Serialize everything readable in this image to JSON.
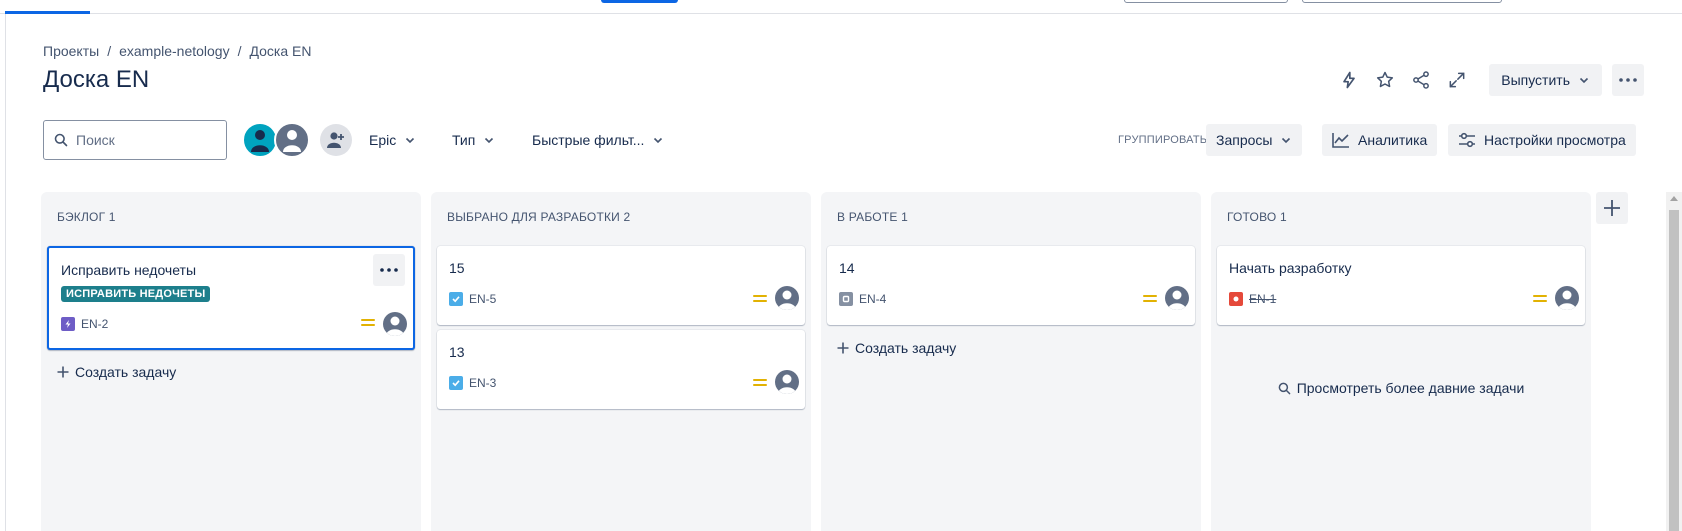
{
  "breadcrumb": {
    "items": [
      "Проекты",
      "example-netology",
      "Доска EN"
    ],
    "separator": "/"
  },
  "page": {
    "title": "Доска EN"
  },
  "header_actions": {
    "icons": [
      "lightning-icon",
      "star-icon",
      "share-icon",
      "expand-icon"
    ],
    "release_label": "Выпустить"
  },
  "filters": {
    "search_placeholder": "Поиск",
    "epic_label": "Epic",
    "type_label": "Тип",
    "quick_filters_label": "Быстрые фильт...",
    "group_label": "ГРУППИРОВАТЬ",
    "group_value": "Запросы",
    "analytics_label": "Аналитика",
    "view_settings_label": "Настройки просмотра"
  },
  "columns": [
    {
      "title": "БЭКЛОГ 1",
      "cards": [
        {
          "title": "Исправить недочеты",
          "label": "ИСПРАВИТЬ НЕДОЧЕТЫ",
          "key": "EN-2",
          "type": "epic",
          "done": false
        }
      ],
      "create_label": "Создать задачу"
    },
    {
      "title": "ВЫБРАНО ДЛЯ РАЗРАБОТКИ 2",
      "cards": [
        {
          "title": "15",
          "key": "EN-5",
          "type": "task",
          "done": false
        },
        {
          "title": "13",
          "key": "EN-3",
          "type": "task",
          "done": false
        }
      ]
    },
    {
      "title": "В РАБОТЕ 1",
      "cards": [
        {
          "title": "14",
          "key": "EN-4",
          "type": "subtask",
          "done": false
        }
      ],
      "create_label": "Создать задачу"
    },
    {
      "title": "ГОТОВО 1",
      "cards": [
        {
          "title": "Начать разработку",
          "key": "EN-1",
          "type": "bug",
          "done": true
        }
      ],
      "view_older_label": "Просмотреть более давние задачи"
    }
  ],
  "colors": {
    "accent": "#0c66e4",
    "label_bg": "#1d7f8c",
    "priority_medium": "#e2b203",
    "epic": "#6e5dc6",
    "task": "#4bade8",
    "subtask": "#8590a2",
    "bug": "#e5493a"
  }
}
